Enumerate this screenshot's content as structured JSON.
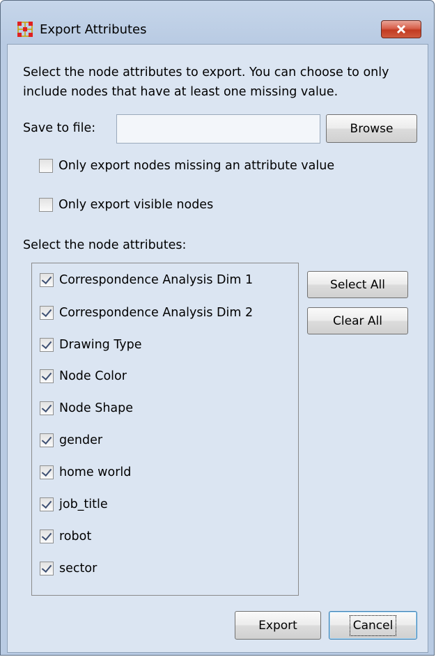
{
  "window": {
    "title": "Export Attributes",
    "accent": "#c23b22"
  },
  "description": "Select the node attributes to export. You can choose to only include nodes that have at least one missing value.",
  "save": {
    "label": "Save to file:",
    "value": "",
    "browse_label": "Browse"
  },
  "options": [
    {
      "label": "Only export nodes missing an attribute value",
      "checked": false
    },
    {
      "label": "Only export visible nodes",
      "checked": false
    }
  ],
  "attributes": {
    "label": "Select the node attributes:",
    "items": [
      {
        "label": "Correspondence Analysis Dim 1",
        "checked": true
      },
      {
        "label": "Correspondence Analysis Dim 2",
        "checked": true
      },
      {
        "label": "Drawing Type",
        "checked": true
      },
      {
        "label": "Node Color",
        "checked": true
      },
      {
        "label": "Node Shape",
        "checked": true
      },
      {
        "label": "gender",
        "checked": true
      },
      {
        "label": "home world",
        "checked": true
      },
      {
        "label": "job_title",
        "checked": true
      },
      {
        "label": "robot",
        "checked": true
      },
      {
        "label": "sector",
        "checked": true
      }
    ]
  },
  "buttons": {
    "select_all": "Select All",
    "clear_all": "Clear All",
    "export": "Export",
    "cancel": "Cancel"
  }
}
